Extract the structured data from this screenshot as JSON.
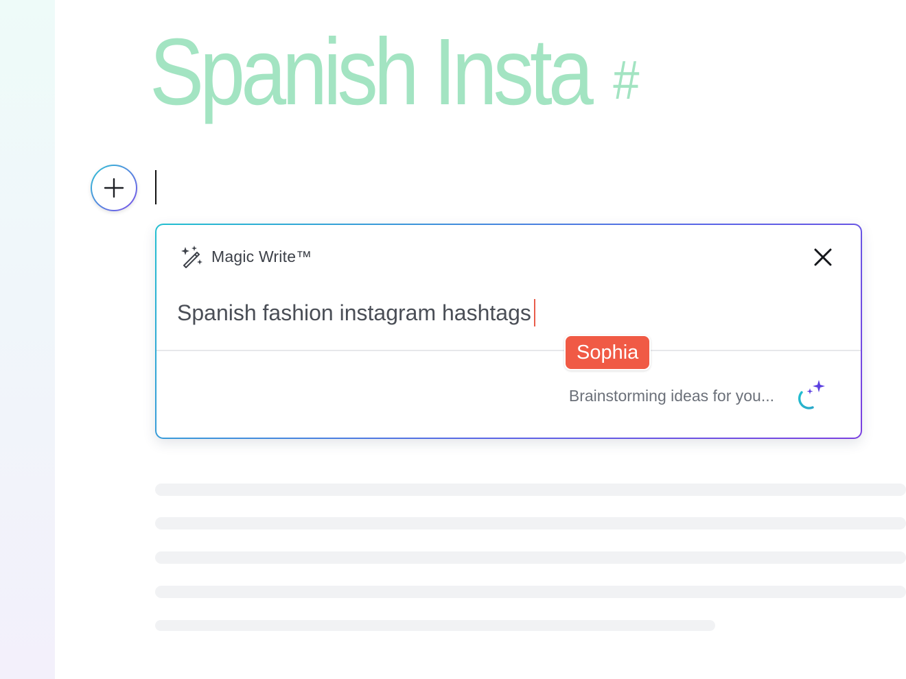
{
  "document": {
    "title": "Spanish Insta",
    "title_suffix": "#",
    "title_color": "#a3e4c2"
  },
  "add_block": {
    "icon": "plus-icon"
  },
  "magic_write": {
    "icon": "magic-wand-icon",
    "title": "Magic Write™",
    "close_icon": "close-icon",
    "prompt": "Spanish fashion instagram hashtags",
    "collaborator_cursor": {
      "name": "Sophia",
      "color": "#f05a45"
    },
    "status": "Brainstorming ideas for you...",
    "status_icon": "sparkle-spinner-icon",
    "accent_start": "#22bfd0",
    "accent_end": "#7a3fe0"
  },
  "loading_placeholder": {
    "line_count": 5
  }
}
